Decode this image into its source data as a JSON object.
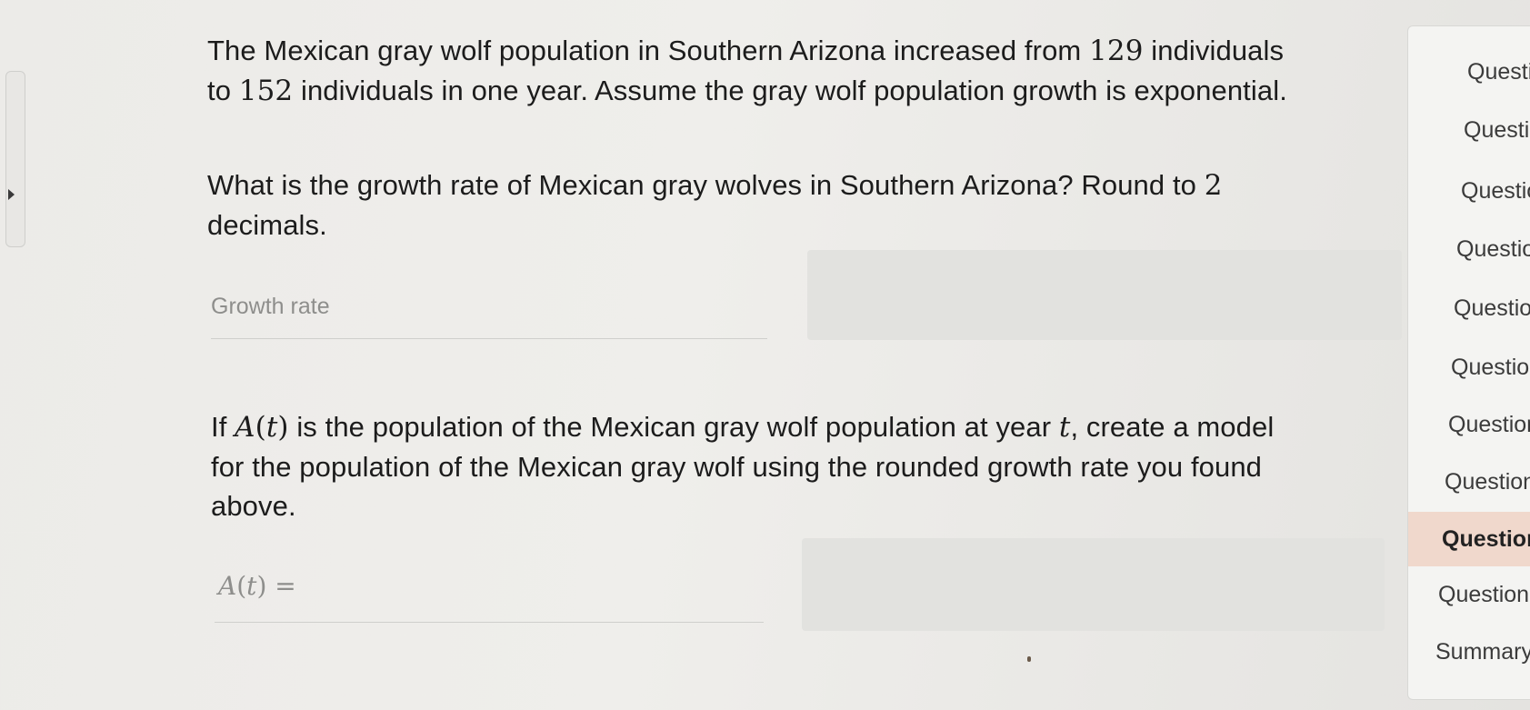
{
  "question1": {
    "intro_line1_a": "The Mexican gray wolf population in Southern Arizona increased from ",
    "intro_num1": "129",
    "intro_line1_b": " individuals",
    "intro_line2_a": "to ",
    "intro_num2": "152",
    "intro_line2_b": " individuals in one year. Assume the gray wolf population growth is exponential.",
    "prompt_line1_a": "What is the growth rate of Mexican gray wolves in Southern Arizona? Round to ",
    "prompt_num": "2",
    "prompt_line2": "decimals.",
    "input_placeholder": "Growth rate"
  },
  "question2": {
    "line1_a": "If ",
    "func_A": "A",
    "func_t": "t",
    "line1_b": " is the population of the Mexican gray wolf population at year ",
    "var_t": "t",
    "line1_c": ", create a model",
    "line2": "for the population of the Mexican gray wolf using the rounded growth rate you found",
    "line3": "above.",
    "input_label_A": "A",
    "input_label_t": "t",
    "input_label_eq": " ="
  },
  "sidebar": {
    "items": [
      {
        "label": "Question"
      },
      {
        "label": "Question"
      },
      {
        "label": "Question"
      },
      {
        "label": "Question"
      },
      {
        "label": "Question"
      },
      {
        "label": "Question"
      },
      {
        "label": "Question"
      },
      {
        "label": "Question"
      },
      {
        "label": "Question",
        "active": true
      },
      {
        "label": "Question"
      },
      {
        "label": "Summary"
      }
    ]
  },
  "colors": {
    "active_item_bg": "#f0d8cc",
    "answer_box_bg": "#e2e2df"
  }
}
